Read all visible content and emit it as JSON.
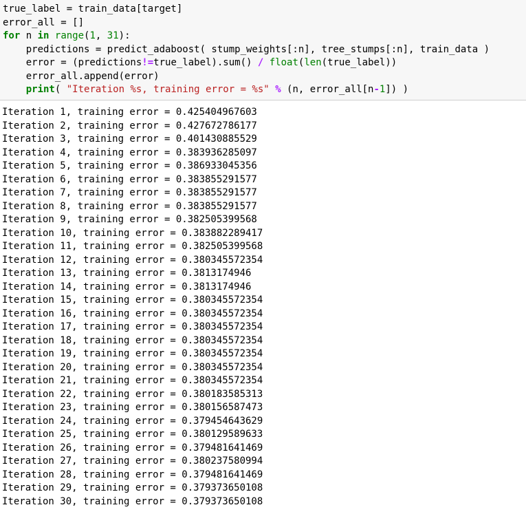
{
  "code": {
    "line1": "true_label = train_data[target]",
    "line2": "error_all = []",
    "line3": {
      "kw_for": "for",
      "var": " n ",
      "kw_in": "in",
      "sp": " ",
      "fn_range": "range",
      "open": "(",
      "num1": "1",
      "comma": ", ",
      "num2": "31",
      "close": "):"
    },
    "line4": "    predictions = predict_adaboost( stump_weights[:n], tree_stumps[:n], train_data )",
    "line5": {
      "a": "    error = (predictions",
      "op": "!=",
      "b": "true_label).sum() ",
      "div": "/",
      "sp": " ",
      "fn_float": "float",
      "open": "(",
      "fn_len": "len",
      "c": "(true_label))"
    },
    "line6": "    error_all.append(error)",
    "line7": {
      "indent": "    ",
      "fn_print": "print",
      "a": "( ",
      "str": "\"Iteration %s, training error = %s\"",
      "sp": " ",
      "op": "%",
      "b": " (n, error_all[n",
      "minus": "-",
      "num": "1",
      "c": "]) )"
    }
  },
  "output": [
    "Iteration 1, training error = 0.425404967603",
    "Iteration 2, training error = 0.427672786177",
    "Iteration 3, training error = 0.401430885529",
    "Iteration 4, training error = 0.383936285097",
    "Iteration 5, training error = 0.386933045356",
    "Iteration 6, training error = 0.383855291577",
    "Iteration 7, training error = 0.383855291577",
    "Iteration 8, training error = 0.383855291577",
    "Iteration 9, training error = 0.382505399568",
    "Iteration 10, training error = 0.383882289417",
    "Iteration 11, training error = 0.382505399568",
    "Iteration 12, training error = 0.380345572354",
    "Iteration 13, training error = 0.3813174946",
    "Iteration 14, training error = 0.3813174946",
    "Iteration 15, training error = 0.380345572354",
    "Iteration 16, training error = 0.380345572354",
    "Iteration 17, training error = 0.380345572354",
    "Iteration 18, training error = 0.380345572354",
    "Iteration 19, training error = 0.380345572354",
    "Iteration 20, training error = 0.380345572354",
    "Iteration 21, training error = 0.380345572354",
    "Iteration 22, training error = 0.380183585313",
    "Iteration 23, training error = 0.380156587473",
    "Iteration 24, training error = 0.379454643629",
    "Iteration 25, training error = 0.380129589633",
    "Iteration 26, training error = 0.379481641469",
    "Iteration 27, training error = 0.380237580994",
    "Iteration 28, training error = 0.379481641469",
    "Iteration 29, training error = 0.379373650108",
    "Iteration 30, training error = 0.379373650108"
  ]
}
